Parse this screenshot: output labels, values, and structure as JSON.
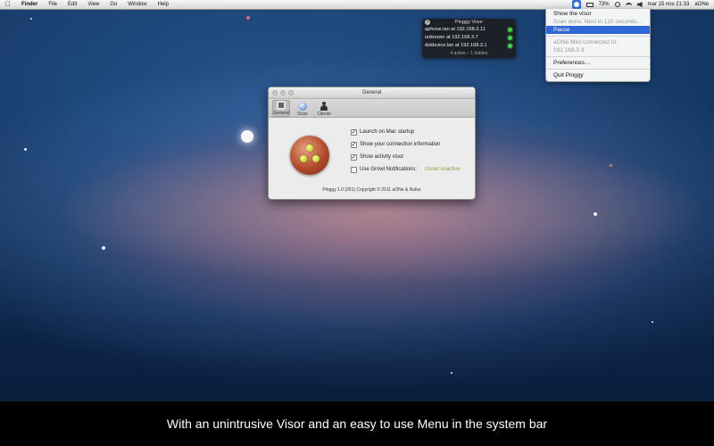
{
  "menubar": {
    "apple_icon": "apple-logo-icon",
    "items": [
      "Finder",
      "File",
      "Edit",
      "View",
      "Go",
      "Window",
      "Help"
    ],
    "status": {
      "battery": "73%",
      "datetime": "mar 15 nov  21:33",
      "user": "aONe"
    }
  },
  "dropdown": {
    "items": [
      {
        "label": "Show the visor",
        "state": "normal"
      },
      {
        "label": "Scan done. Next in 120 seconds…",
        "state": "disabled"
      },
      {
        "label": "Pause",
        "state": "selected"
      },
      {
        "label": "aONe-Mini connected to:",
        "state": "disabled"
      },
      {
        "label": "192.168.3.3",
        "state": "disabled"
      },
      {
        "label": "Preferences…",
        "state": "normal"
      },
      {
        "label": "Quit Pinggy",
        "state": "normal"
      }
    ]
  },
  "visor": {
    "title": "Pinggy Visor",
    "rows": [
      {
        "text": "aphone.lan at 192.168.3.11",
        "status": "green"
      },
      {
        "text": "unknown at 192.168.3.7",
        "status": "green"
      },
      {
        "text": "dsldevice.lan at 192.168.3.1",
        "status": "green"
      }
    ],
    "footer": "4 active – 1 hidden"
  },
  "prefs": {
    "title": "General",
    "toolbar": [
      {
        "label": "General",
        "icon": "switch-icon"
      },
      {
        "label": "Scan",
        "icon": "globe-icon"
      },
      {
        "label": "Clients",
        "icon": "person-icon"
      }
    ],
    "options": [
      {
        "label": "Launch on Mac startup",
        "checked": true
      },
      {
        "label": "Show your connection information",
        "checked": true
      },
      {
        "label": "Show activity visor",
        "checked": true
      },
      {
        "label": "Use Growl Notifications:",
        "checked": false
      }
    ],
    "growl_status": "Growl unactive",
    "copyright": "Pinggy 1.0 (251) Copyright © 2011 aONe & Rufus"
  },
  "caption": "With an unintrusive Visor and an easy to use Menu in the system bar",
  "colors": {
    "menu_highlight": "#2f66d6",
    "status_green": "#3fd24c",
    "growl_status": "#8aa04b",
    "caption_bg": "#000000"
  }
}
